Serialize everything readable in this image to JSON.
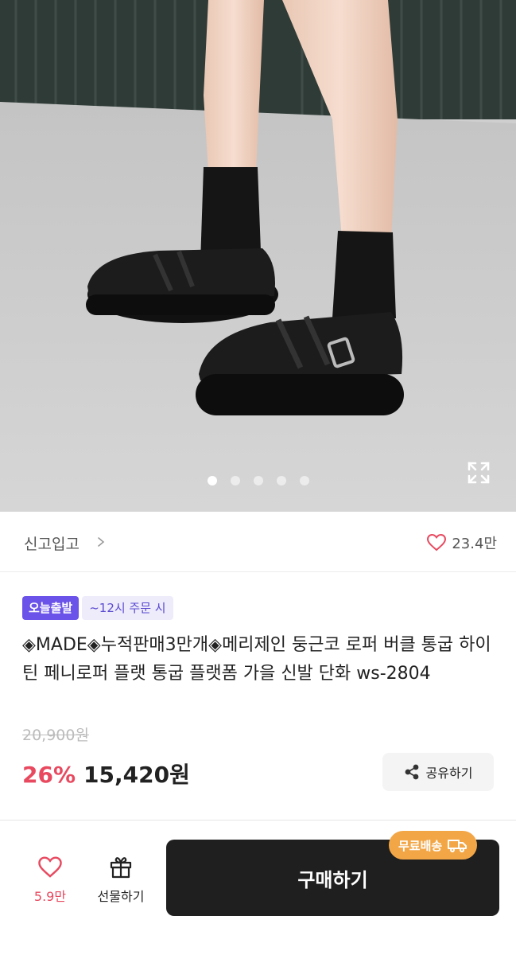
{
  "gallery": {
    "dots": [
      true,
      false,
      false,
      false,
      false
    ],
    "expand_icon": "expand-icon"
  },
  "store": {
    "name": "신고입고",
    "chevron_icon": "chevron-right-icon",
    "like_icon": "heart-icon",
    "like_count": "23.4만"
  },
  "badges": {
    "today": "오늘출발",
    "order_cutoff": "~12시 주문 시"
  },
  "product": {
    "title": "◈MADE◈누적판매3만개◈메리제인 둥근코 로퍼 버클 통굽 하이틴 페니로퍼 플랫 통굽 플랫폼 가을 신발 단화 ws-2804",
    "original_price": "20,900원",
    "discount": "26%",
    "price": "15,420원"
  },
  "share": {
    "icon": "share-icon",
    "label": "공유하기"
  },
  "bottom": {
    "wish_icon": "heart-icon",
    "wish_count": "5.9만",
    "gift_icon": "gift-icon",
    "gift_label": "선물하기",
    "buy_label": "구매하기",
    "free_shipping_label": "무료배송",
    "truck_icon": "truck-icon"
  },
  "colors": {
    "accent_red": "#e8495f",
    "badge_purple": "#6b52e8",
    "buy_button": "#1f1f1f",
    "free_ship_orange": "#f3a646"
  }
}
